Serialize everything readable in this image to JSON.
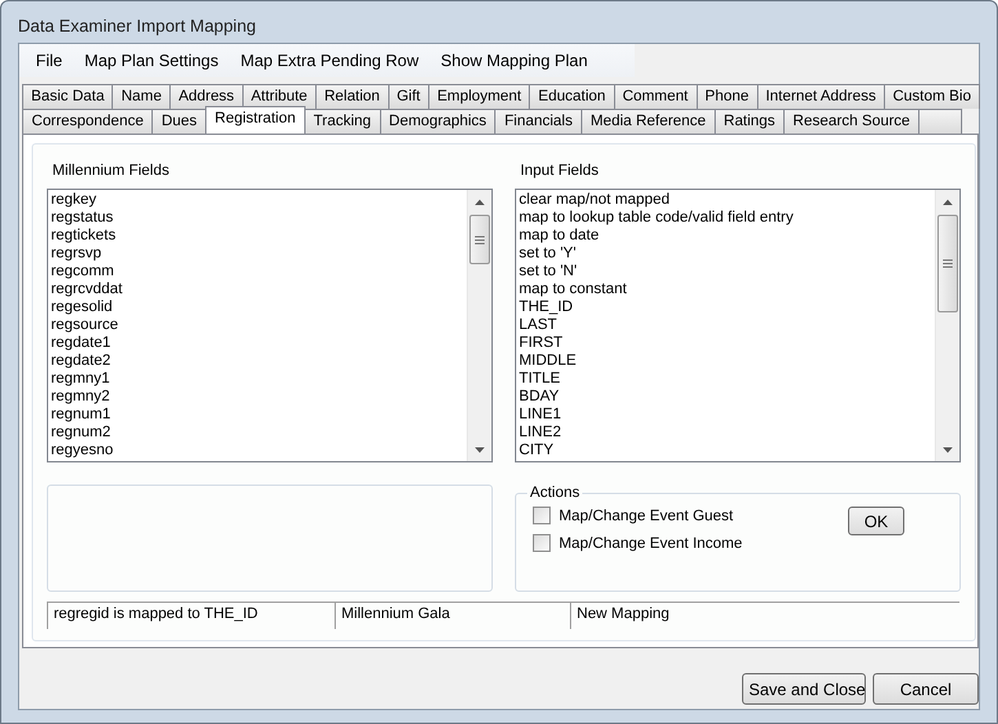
{
  "window": {
    "title": "Data Examiner Import Mapping"
  },
  "menu": [
    "File",
    "Map Plan Settings",
    "Map Extra Pending Row",
    "Show Mapping Plan"
  ],
  "tab_rows": [
    {
      "tabs": [
        {
          "label": "Basic Data",
          "selected": false
        },
        {
          "label": "Name",
          "selected": false
        },
        {
          "label": "Address",
          "selected": false
        },
        {
          "label": "Attribute",
          "selected": false
        },
        {
          "label": "Relation",
          "selected": false
        },
        {
          "label": "Gift",
          "selected": false
        },
        {
          "label": "Employment",
          "selected": false
        },
        {
          "label": "Education",
          "selected": false
        },
        {
          "label": "Comment",
          "selected": false
        },
        {
          "label": "Phone",
          "selected": false
        },
        {
          "label": "Internet Address",
          "selected": false
        },
        {
          "label": "Custom Bio",
          "selected": false
        }
      ]
    },
    {
      "tabs": [
        {
          "label": "Correspondence",
          "selected": false
        },
        {
          "label": "Dues",
          "selected": false
        },
        {
          "label": "Registration",
          "selected": true
        },
        {
          "label": "Tracking",
          "selected": false
        },
        {
          "label": "Demographics",
          "selected": false
        },
        {
          "label": "Financials",
          "selected": false
        },
        {
          "label": "Media Reference",
          "selected": false
        },
        {
          "label": "Ratings",
          "selected": false
        },
        {
          "label": "Research Source",
          "selected": false
        }
      ]
    }
  ],
  "millennium_fields": {
    "label": "Millennium Fields",
    "items": [
      "regkey",
      "regstatus",
      "regtickets",
      "regrsvp",
      "regcomm",
      "regrcvddat",
      "regesolid",
      "regsource",
      "regdate1",
      "regdate2",
      "regmny1",
      "regmny2",
      "regnum1",
      "regnum2",
      "regyesno"
    ]
  },
  "input_fields": {
    "label": "Input Fields",
    "items": [
      "clear map/not mapped",
      "map to lookup table code/valid field entry",
      "map to date",
      "set to 'Y'",
      "set to 'N'",
      "map to constant",
      "THE_ID",
      "LAST",
      "FIRST",
      "MIDDLE",
      "TITLE",
      "BDAY",
      "LINE1",
      "LINE2",
      "CITY"
    ]
  },
  "actions": {
    "label": "Actions",
    "options": [
      {
        "label": "Map/Change Event Guest",
        "checked": false
      },
      {
        "label": "Map/Change Event Income",
        "checked": false
      }
    ],
    "ok_button": "OK"
  },
  "status_bar": [
    "regregid is mapped to THE_ID",
    "Millennium Gala",
    "New Mapping"
  ],
  "buttons": [
    "Save and Close",
    "Cancel"
  ]
}
